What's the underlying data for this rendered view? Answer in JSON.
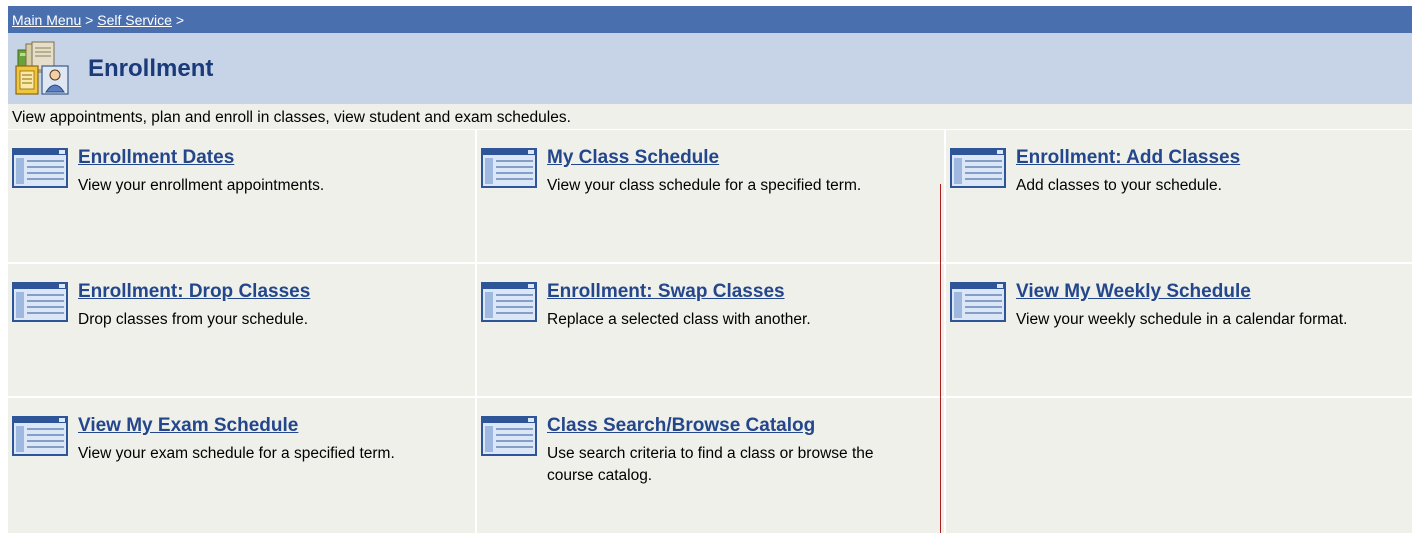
{
  "breadcrumb": {
    "items": [
      {
        "label": "Main Menu"
      },
      {
        "label": "Self Service"
      }
    ],
    "separator": ">"
  },
  "page": {
    "title": "Enrollment",
    "icon": "enrollment-folder-icon",
    "description": "View appointments, plan and enroll in classes, view student and exam schedules."
  },
  "links": [
    {
      "title": "Enrollment Dates",
      "description": "View your enrollment appointments.",
      "icon": "page-icon"
    },
    {
      "title": "My Class Schedule",
      "description": "View your class schedule for a specified term.",
      "icon": "page-icon"
    },
    {
      "title": "Enrollment: Add Classes",
      "description": "Add classes to your schedule.",
      "icon": "page-icon"
    },
    {
      "title": "Enrollment: Drop Classes",
      "description": "Drop classes from your schedule.",
      "icon": "page-icon"
    },
    {
      "title": "Enrollment: Swap Classes",
      "description": "Replace a selected class with another.",
      "icon": "page-icon"
    },
    {
      "title": "View My Weekly Schedule",
      "description": "View your weekly schedule in a calendar format.",
      "icon": "page-icon"
    },
    {
      "title": "View My Exam Schedule",
      "description": "View your exam schedule for a specified term.",
      "icon": "page-icon"
    },
    {
      "title": "Class Search/Browse Catalog",
      "description": "Use search criteria to find a class or browse the course catalog.",
      "icon": "page-icon"
    }
  ],
  "colors": {
    "nav_bar": "#4a6fae",
    "title_bar": "#c7d3e6",
    "cell_background": "#eef0e9",
    "link": "#23468c",
    "title_text": "#1b3a7a"
  }
}
